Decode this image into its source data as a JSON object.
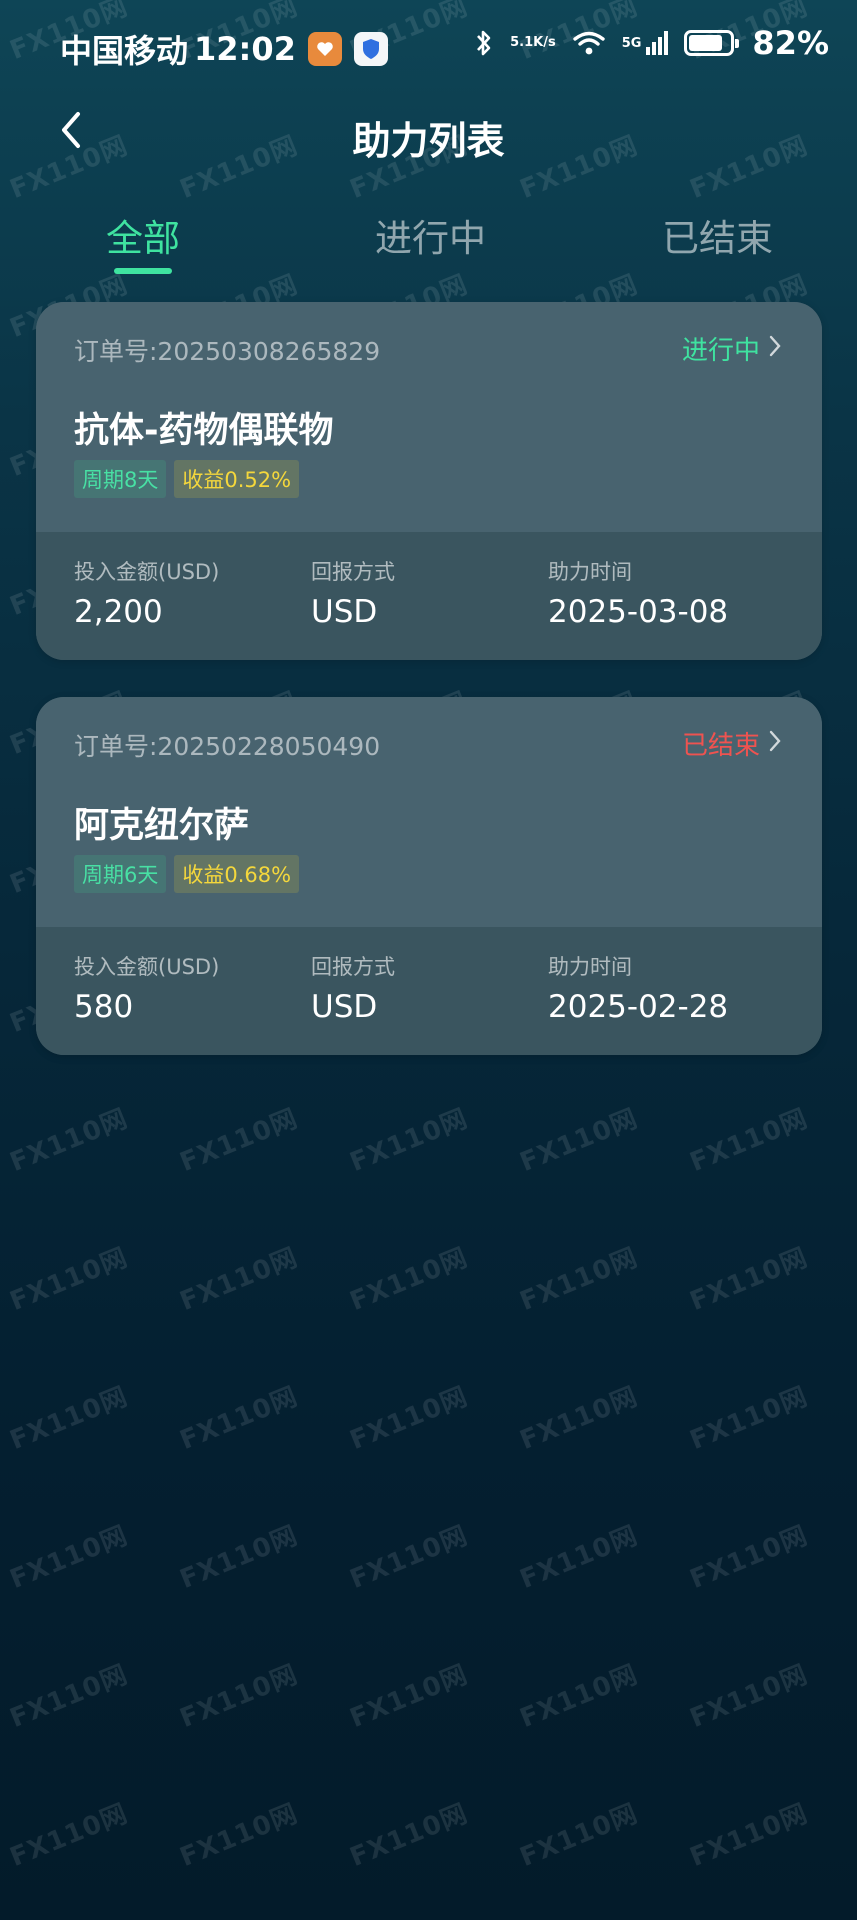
{
  "status_bar": {
    "carrier": "中国移动",
    "time": "12:02",
    "net_speed_value": "5.1",
    "net_speed_unit": "K/s",
    "network": "5G",
    "battery": "82%",
    "battery_level": 0.82
  },
  "header": {
    "title": "助力列表",
    "back_icon": "chevron-left-icon"
  },
  "tabs": [
    {
      "label": "全部",
      "active": true
    },
    {
      "label": "进行中",
      "active": false
    },
    {
      "label": "已结束",
      "active": false
    }
  ],
  "orders": [
    {
      "order_no": "订单号:20250308265829",
      "status": "进行中",
      "status_color": "#3fe3a0",
      "name": "抗体-药物偶联物",
      "tag_period": "周期8天",
      "tag_yield": "收益0.52%",
      "amount_label": "投入金额(USD)",
      "amount": "2,200",
      "return_label": "回报方式",
      "return_value": "USD",
      "time_label": "助力时间",
      "time_value": "2025-03-08"
    },
    {
      "order_no": "订单号:20250228050490",
      "status": "已结束",
      "status_color": "#ef5350",
      "name": "阿克纽尔萨",
      "tag_period": "周期6天",
      "tag_yield": "收益0.68%",
      "amount_label": "投入金额(USD)",
      "amount": "580",
      "return_label": "回报方式",
      "return_value": "USD",
      "time_label": "助力时间",
      "time_value": "2025-02-28"
    }
  ],
  "watermark": "FX110网",
  "colors": {
    "accent": "#3fe3a0",
    "ended": "#ef5350",
    "yield_tag": "#f4d73c"
  }
}
